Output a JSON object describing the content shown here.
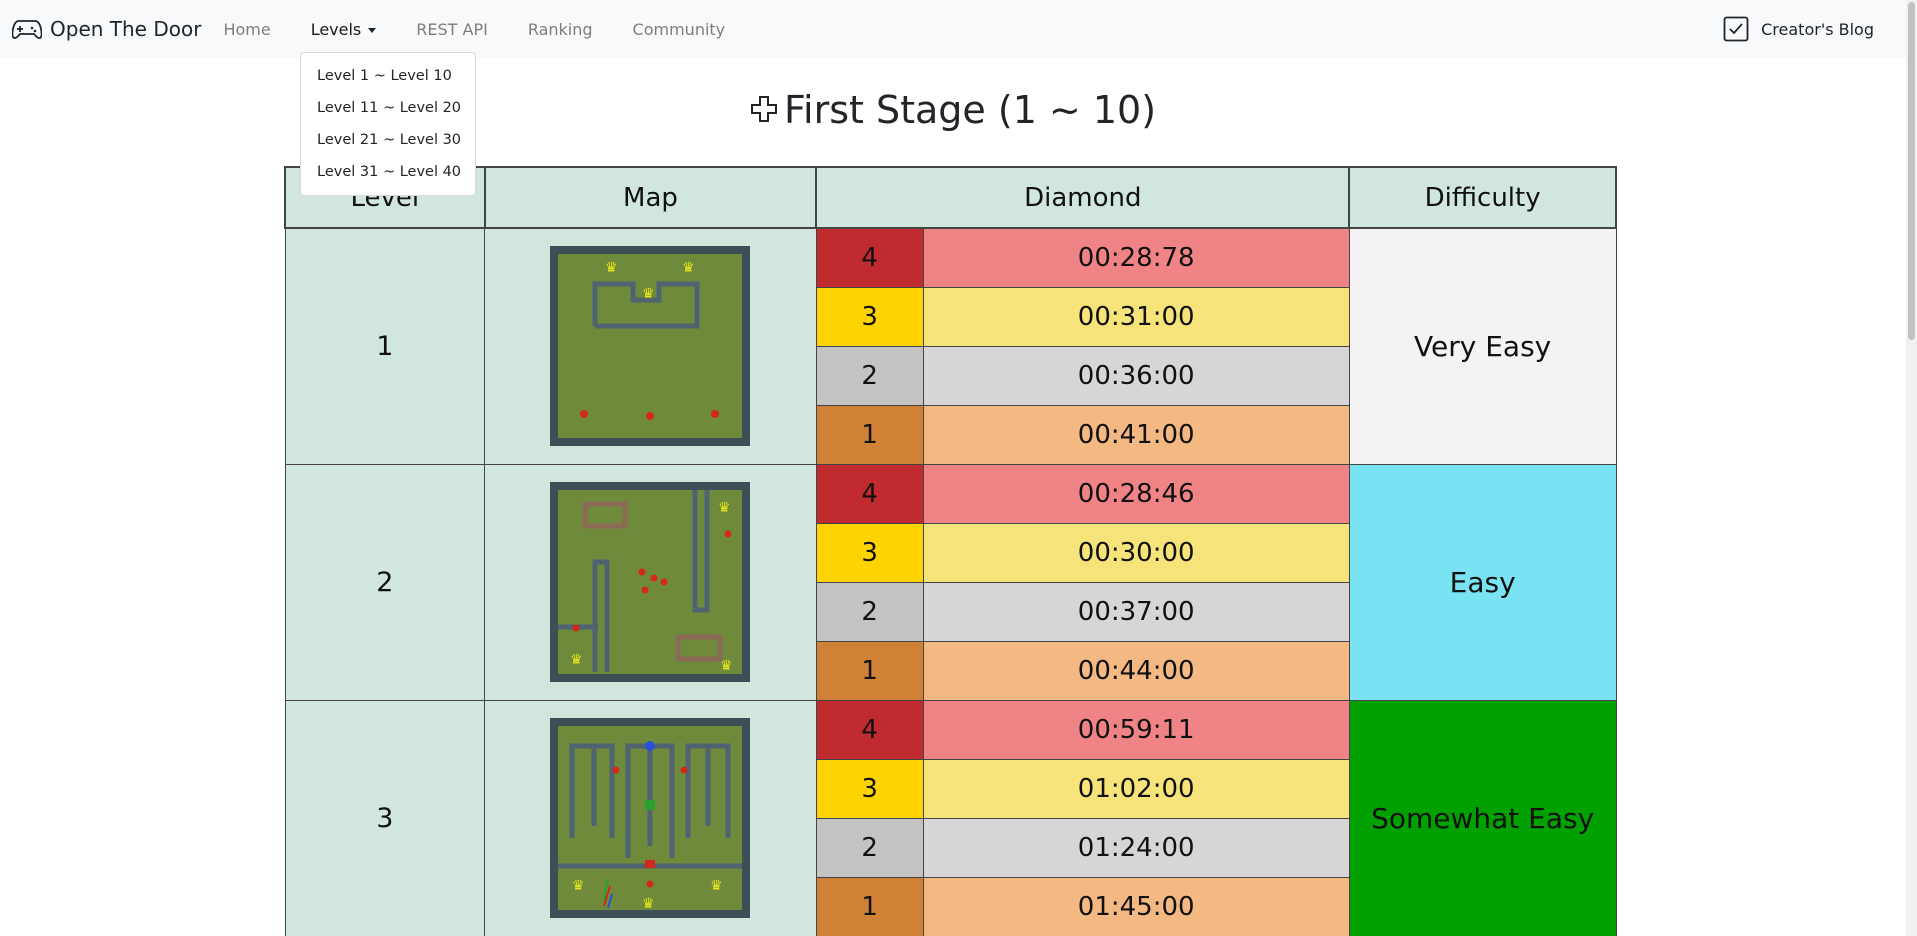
{
  "navbar": {
    "brand": "Open The Door",
    "links": [
      "Home",
      "Levels",
      "REST API",
      "Ranking",
      "Community"
    ],
    "blog_label": "Creator's Blog"
  },
  "dropdown": {
    "items": [
      "Level 1 ~ Level 10",
      "Level 11 ~ Level 20",
      "Level 21 ~ Level 30",
      "Level 31 ~ Level 40"
    ]
  },
  "stage": {
    "title": "First Stage (1 ~ 10)"
  },
  "table": {
    "headers": [
      "Level",
      "Map",
      "Diamond",
      "Difficulty"
    ],
    "rows": [
      {
        "level": "1",
        "difficulty": "Very Easy",
        "difficulty_color": "#f3f3f3",
        "diamonds": [
          {
            "rank": "4",
            "time": "00:28:78"
          },
          {
            "rank": "3",
            "time": "00:31:00"
          },
          {
            "rank": "2",
            "time": "00:36:00"
          },
          {
            "rank": "1",
            "time": "00:41:00"
          }
        ]
      },
      {
        "level": "2",
        "difficulty": "Easy",
        "difficulty_color": "#79e3f3",
        "diamonds": [
          {
            "rank": "4",
            "time": "00:28:46"
          },
          {
            "rank": "3",
            "time": "00:30:00"
          },
          {
            "rank": "2",
            "time": "00:37:00"
          },
          {
            "rank": "1",
            "time": "00:44:00"
          }
        ]
      },
      {
        "level": "3",
        "difficulty": "Somewhat Easy",
        "difficulty_color": "#00a100",
        "diamonds": [
          {
            "rank": "4",
            "time": "00:59:11"
          },
          {
            "rank": "3",
            "time": "01:02:00"
          },
          {
            "rank": "2",
            "time": "01:24:00"
          },
          {
            "rank": "1",
            "time": "01:45:00"
          }
        ]
      }
    ]
  },
  "colors": {
    "header_bg": "#d1e7dd",
    "rank4": "#c12a2e",
    "time4": "#f08385",
    "rank3": "#ffd300",
    "time3": "#f6e37a",
    "rank2": "#c4c3c4",
    "time2": "#d8d5d6",
    "rank1": "#d18136",
    "time1": "#f4b882"
  }
}
